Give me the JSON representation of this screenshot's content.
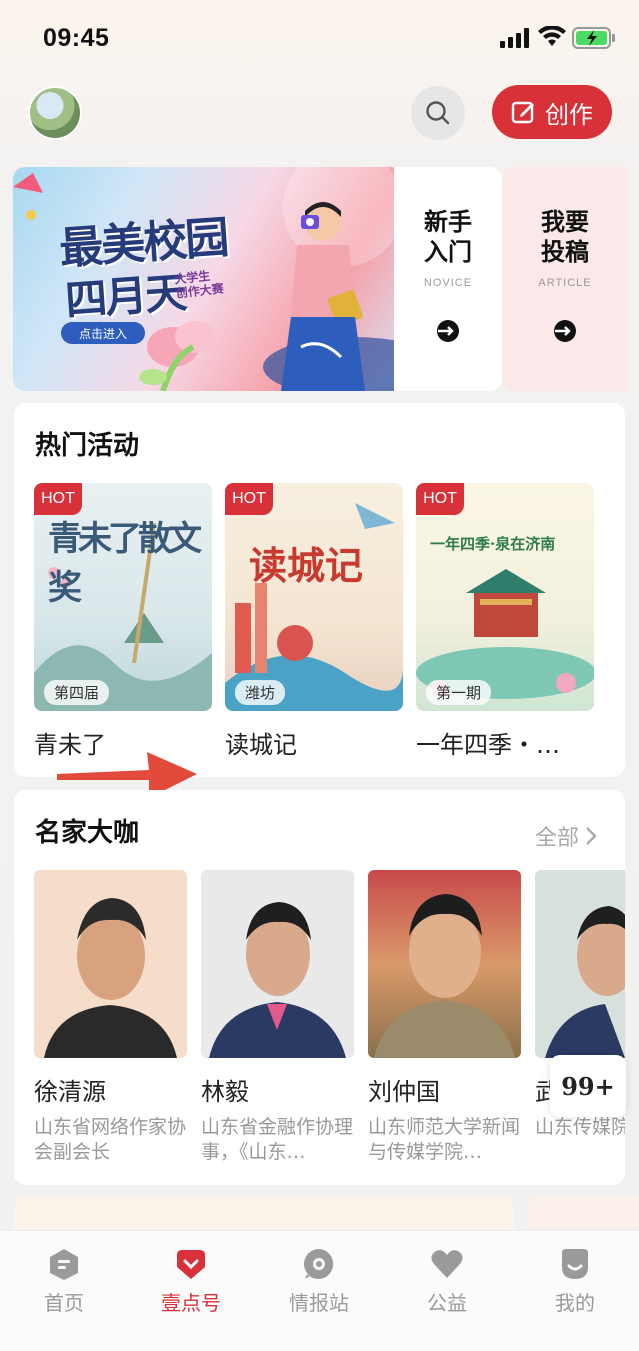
{
  "status_bar": {
    "time": "09:45"
  },
  "header": {
    "create_label": "创作"
  },
  "banner": {
    "title_line1": "最美校园",
    "title_line2": "四月天",
    "subtitle_line1": "大学生",
    "subtitle_line2": "创作大赛",
    "enter_label": "点击进入",
    "novice": {
      "title_line1": "新手",
      "title_line2": "入门",
      "subtitle": "NOVICE"
    },
    "article": {
      "title_line1": "我要",
      "title_line2": "投稿",
      "subtitle": "ARTICLE"
    }
  },
  "hot_activities": {
    "title": "热门活动",
    "items": [
      {
        "badge": "HOT",
        "tag": "第四届",
        "name": "青未了",
        "art_text": "青未了散文奖"
      },
      {
        "badge": "HOT",
        "tag": "潍坊",
        "name": "读城记",
        "art_text": "读城记"
      },
      {
        "badge": "HOT",
        "tag": "第一期",
        "name": "一年四季・…",
        "art_text": "一年四季·泉在济南"
      }
    ]
  },
  "experts": {
    "title": "名家大咖",
    "all_label": "全部",
    "items": [
      {
        "name": "徐清源",
        "desc": "山东省网络作家协会副会长"
      },
      {
        "name": "林毅",
        "desc": "山东省金融作协理事，《山东…"
      },
      {
        "name": "刘仲国",
        "desc": "山东师范大学新闻与传媒学院…"
      },
      {
        "name": "武",
        "desc": "山东传媒院副教授"
      }
    ]
  },
  "floating_badge": "99+",
  "tabbar": {
    "items": [
      {
        "label": "首页"
      },
      {
        "label": "壹点号"
      },
      {
        "label": "情报站"
      },
      {
        "label": "公益"
      },
      {
        "label": "我的"
      }
    ],
    "active": "壹点号"
  },
  "colors": {
    "accent": "#d8313a",
    "muted": "#9a9a9a"
  }
}
